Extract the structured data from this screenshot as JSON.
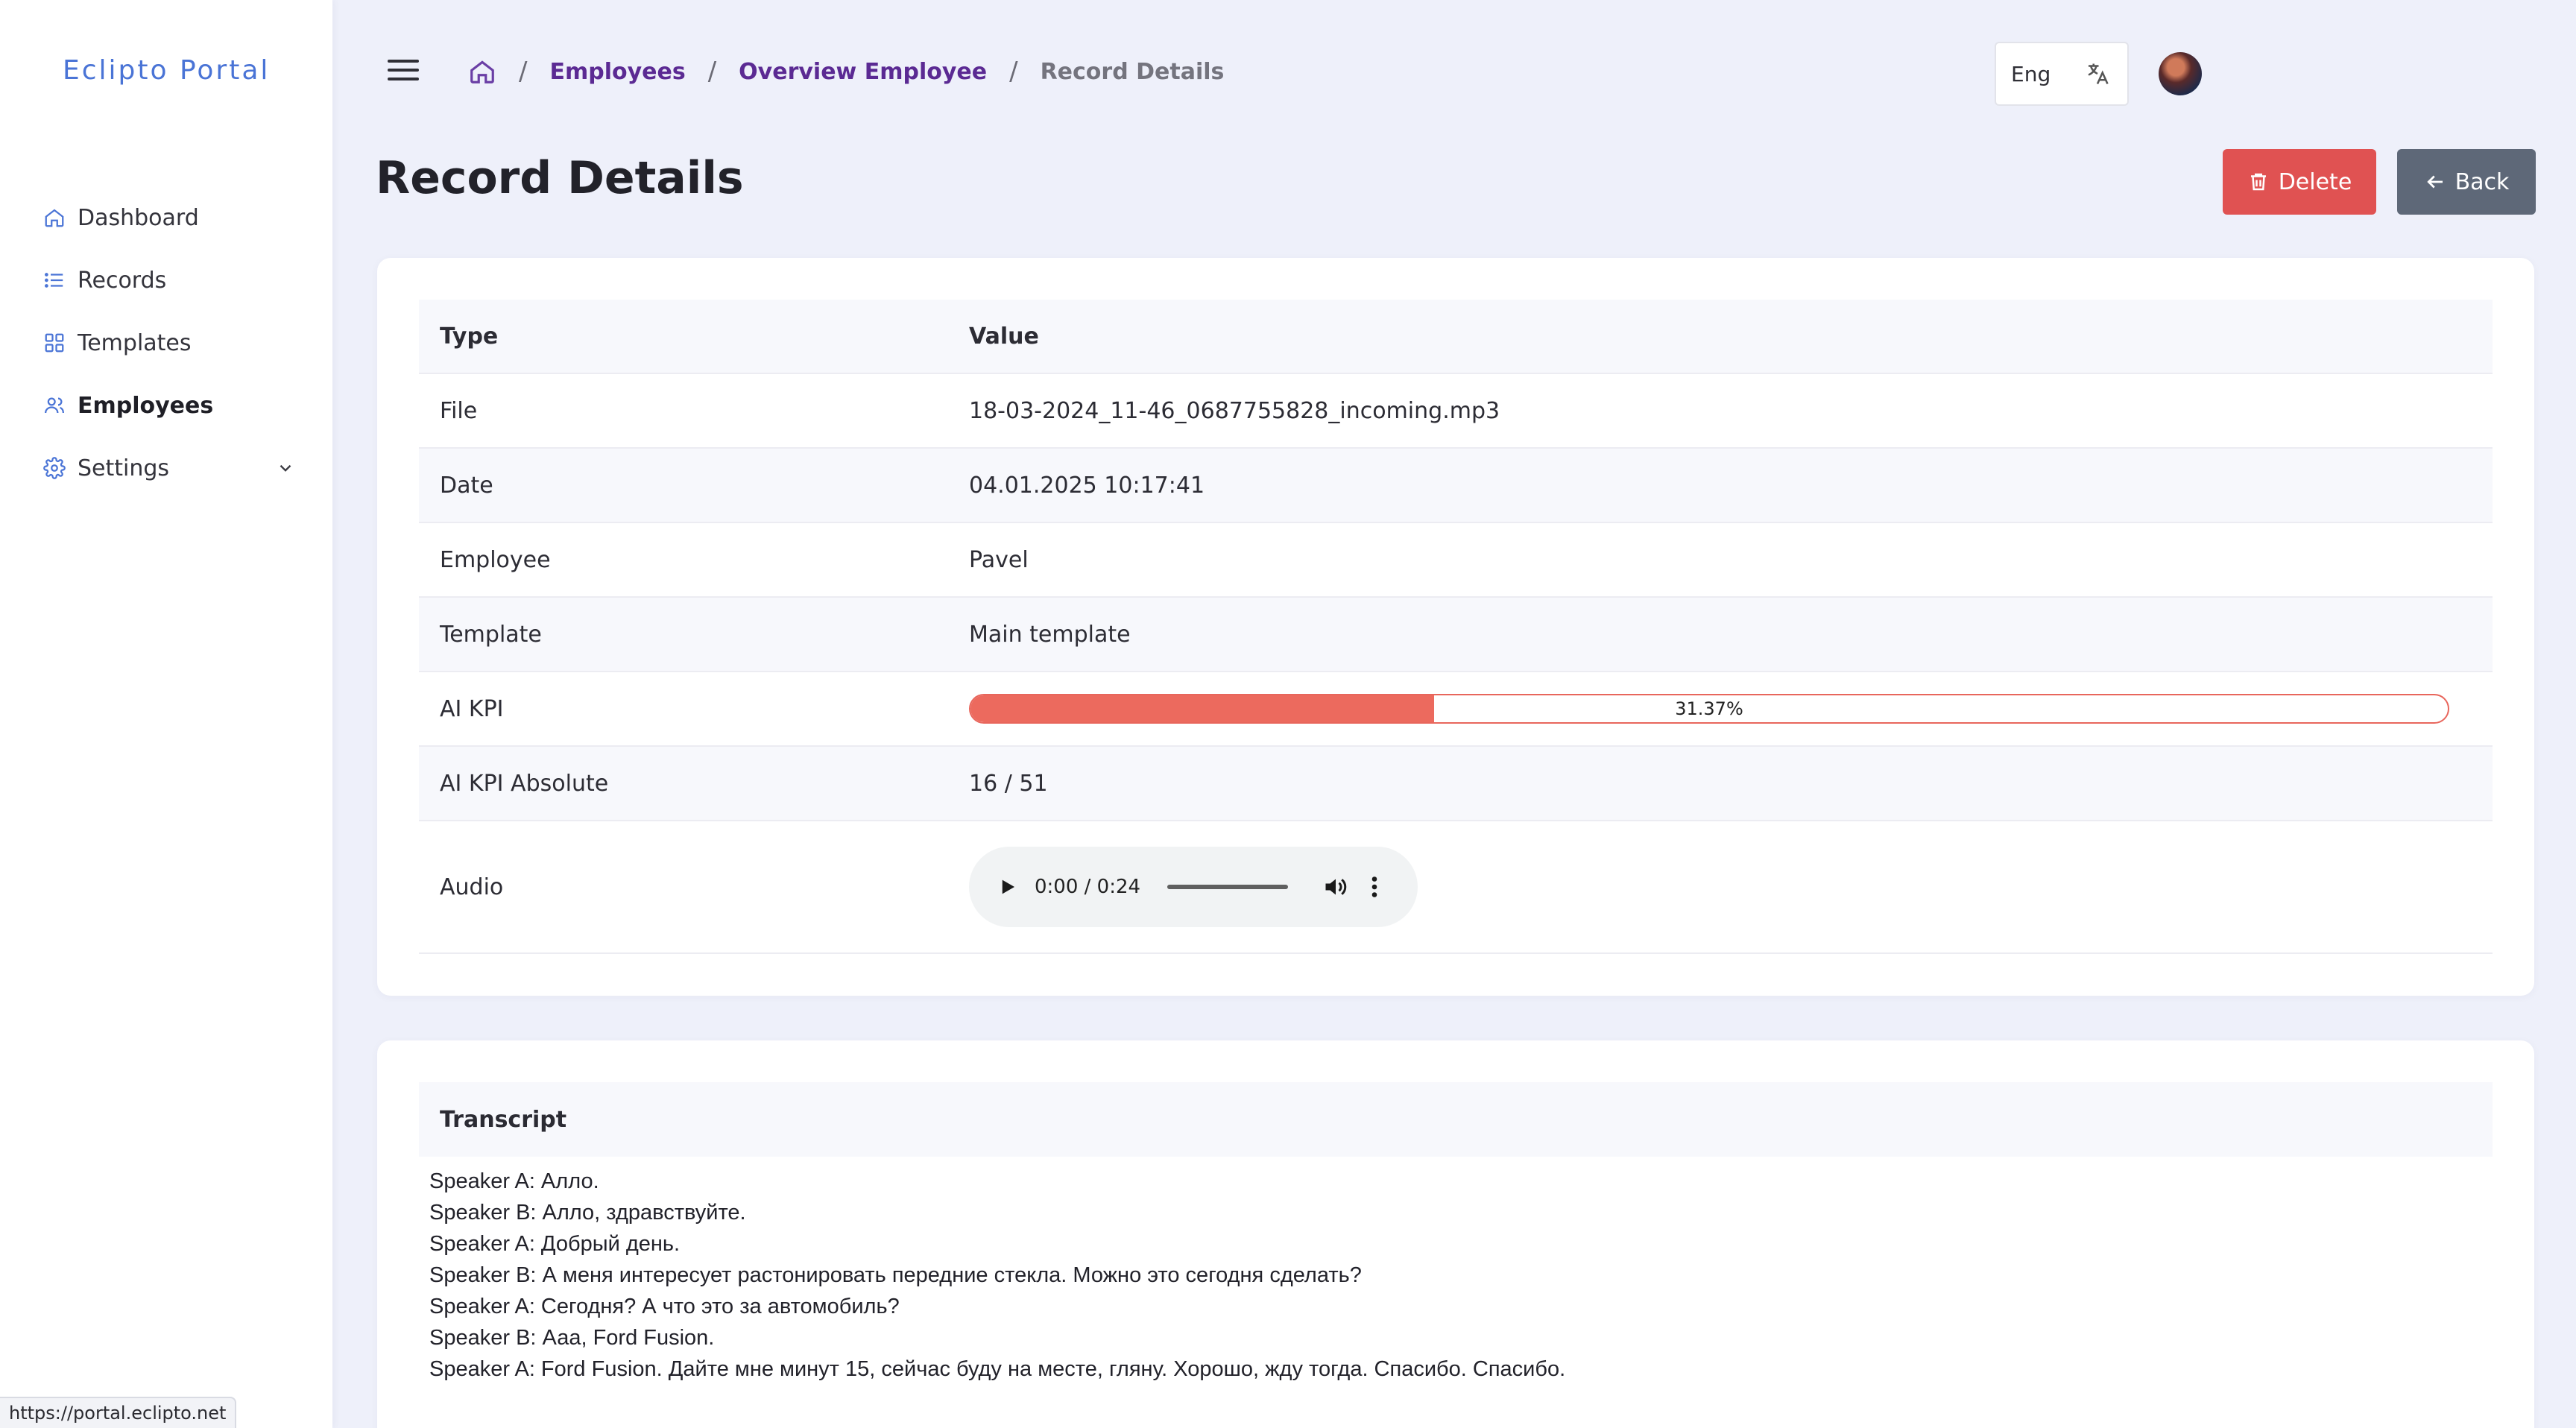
{
  "brand": "Eclipto Portal",
  "sidebar": {
    "items": [
      {
        "label": "Dashboard",
        "icon": "home-icon"
      },
      {
        "label": "Records",
        "icon": "list-icon"
      },
      {
        "label": "Templates",
        "icon": "grid-icon"
      },
      {
        "label": "Employees",
        "icon": "users-icon",
        "active": true
      },
      {
        "label": "Settings",
        "icon": "gear-icon",
        "expandable": true
      }
    ]
  },
  "breadcrumb": {
    "home_icon": "home-icon",
    "items": [
      "Employees",
      "Overview Employee"
    ],
    "current": "Record Details",
    "separator": "/"
  },
  "language": {
    "label": "Eng",
    "icon": "translate-icon"
  },
  "page": {
    "title": "Record Details",
    "delete_label": "Delete",
    "back_label": "Back"
  },
  "details": {
    "headers": [
      "Type",
      "Value"
    ],
    "rows": [
      {
        "type": "File",
        "value": "18-03-2024_11-46_0687755828_incoming.mp3"
      },
      {
        "type": "Date",
        "value": "04.01.2025 10:17:41"
      },
      {
        "type": "Employee",
        "value": "Pavel"
      },
      {
        "type": "Template",
        "value": "Main template"
      },
      {
        "type": "AI KPI",
        "value": "31.37%",
        "progress": 31.37
      },
      {
        "type": "AI KPI Absolute",
        "value": "16 / 51"
      },
      {
        "type": "Audio",
        "value": ""
      }
    ]
  },
  "audio": {
    "time": "0:00 / 0:24"
  },
  "transcript": {
    "title": "Transcript",
    "lines": [
      "Speaker A: Алло.",
      "Speaker B: Алло, здравствуйте.",
      "Speaker A: Добрый день.",
      "Speaker B: А меня интересует растонировать передние стекла. Можно это сегодня сделать?",
      "Speaker A: Сегодня? А что это за автомобиль?",
      "Speaker B: Ааа, Ford Fusion.",
      "Speaker A: Ford Fusion. Дайте мне минут 15, сейчас буду на месте, гляну. Хорошо, жду тогда. Спасибо. Спасибо."
    ]
  },
  "status_bar": {
    "url": "https://portal.eclipto.net"
  },
  "colors": {
    "accent": "#4a74d6",
    "breadcrumb_link": "#5b2a93",
    "delete": "#e05252",
    "back": "#5e6878",
    "kpi": "#ec6a5e"
  }
}
